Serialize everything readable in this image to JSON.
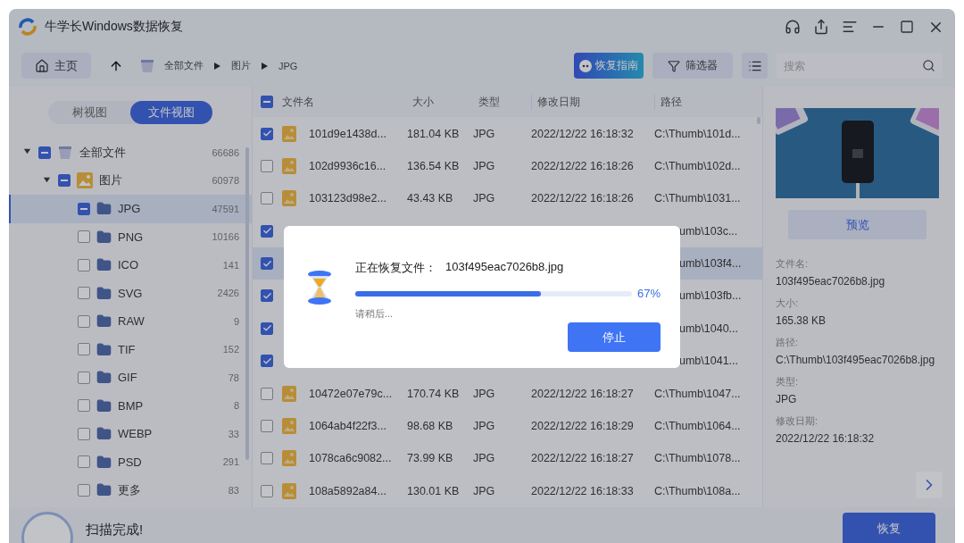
{
  "window": {
    "title": "牛学长Windows数据恢复"
  },
  "toolbar": {
    "home": "主页",
    "breadcrumb": [
      "全部文件",
      "图片",
      "JPG"
    ],
    "guide_button": "恢复指南",
    "filter_button": "筛选器",
    "search": {
      "placeholder": "搜索"
    }
  },
  "view_tabs": [
    {
      "label": "树视图",
      "selected": false
    },
    {
      "label": "文件视图",
      "selected": true
    }
  ],
  "tree": [
    {
      "label": "全部文件",
      "count": "66686",
      "kind": "drive",
      "checked": true,
      "partial": true,
      "expanded": true,
      "selected": false,
      "children": [
        {
          "label": "图片",
          "count": "60978",
          "kind": "images",
          "checked": true,
          "partial": true,
          "expanded": true,
          "selected": false,
          "children": [
            {
              "label": "JPG",
              "count": "47591",
              "kind": "folder",
              "checked": true,
              "partial": true,
              "selected": true
            },
            {
              "label": "PNG",
              "count": "10166",
              "kind": "folder",
              "checked": false,
              "partial": false,
              "selected": false
            },
            {
              "label": "ICO",
              "count": "141",
              "kind": "folder",
              "checked": false,
              "partial": false,
              "selected": false
            },
            {
              "label": "SVG",
              "count": "2426",
              "kind": "folder",
              "checked": false,
              "partial": false,
              "selected": false
            },
            {
              "label": "RAW",
              "count": "9",
              "kind": "folder",
              "checked": false,
              "partial": false,
              "selected": false
            },
            {
              "label": "TIF",
              "count": "152",
              "kind": "folder",
              "checked": false,
              "partial": false,
              "selected": false
            },
            {
              "label": "GIF",
              "count": "78",
              "kind": "folder",
              "checked": false,
              "partial": false,
              "selected": false
            },
            {
              "label": "BMP",
              "count": "8",
              "kind": "folder",
              "checked": false,
              "partial": false,
              "selected": false
            },
            {
              "label": "WEBP",
              "count": "33",
              "kind": "folder",
              "checked": false,
              "partial": false,
              "selected": false
            },
            {
              "label": "PSD",
              "count": "291",
              "kind": "folder",
              "checked": false,
              "partial": false,
              "selected": false
            },
            {
              "label": "更多",
              "count": "83",
              "kind": "folder",
              "checked": false,
              "partial": false,
              "selected": false
            }
          ]
        }
      ]
    }
  ],
  "table": {
    "header_checked": true,
    "header_partial": true,
    "columns": [
      "文件名",
      "大小",
      "类型",
      "修改日期",
      "路径"
    ],
    "rows": [
      {
        "kind": "full",
        "checked": true,
        "selected": false,
        "name": "101d9e1438d...",
        "size": "181.04 KB",
        "type": "JPG",
        "date": "2022/12/22 16:18:32",
        "path": "C:\\Thumb\\101d..."
      },
      {
        "kind": "full",
        "checked": false,
        "selected": false,
        "name": "102d9936c16...",
        "size": "136.54 KB",
        "type": "JPG",
        "date": "2022/12/22 16:18:26",
        "path": "C:\\Thumb\\102d..."
      },
      {
        "kind": "full",
        "checked": false,
        "selected": false,
        "name": "103123d98e2...",
        "size": "43.43 KB",
        "type": "JPG",
        "date": "2022/12/22 16:18:26",
        "path": "C:\\Thumb\\1031..."
      },
      {
        "kind": "covered",
        "checked": true,
        "selected": false,
        "path": "umb\\103c..."
      },
      {
        "kind": "covered",
        "checked": true,
        "selected": true,
        "path": "umb\\103f4..."
      },
      {
        "kind": "covered",
        "checked": true,
        "selected": false,
        "path": "umb\\103fb..."
      },
      {
        "kind": "covered",
        "checked": true,
        "selected": false,
        "path": "umb\\1040..."
      },
      {
        "kind": "covered",
        "checked": true,
        "selected": false,
        "path": "umb\\1041..."
      },
      {
        "kind": "full",
        "checked": false,
        "selected": false,
        "name": "10472e07e79c...",
        "size": "170.74 KB",
        "type": "JPG",
        "date": "2022/12/22 16:18:27",
        "path": "C:\\Thumb\\1047..."
      },
      {
        "kind": "full",
        "checked": false,
        "selected": false,
        "name": "1064ab4f22f3...",
        "size": "98.68 KB",
        "type": "JPG",
        "date": "2022/12/22 16:18:29",
        "path": "C:\\Thumb\\1064..."
      },
      {
        "kind": "full",
        "checked": false,
        "selected": false,
        "name": "1078ca6c9082...",
        "size": "73.99 KB",
        "type": "JPG",
        "date": "2022/12/22 16:18:27",
        "path": "C:\\Thumb\\1078..."
      },
      {
        "kind": "full",
        "checked": false,
        "selected": false,
        "name": "108a5892a84...",
        "size": "130.01 KB",
        "type": "JPG",
        "date": "2022/12/22 16:18:33",
        "path": "C:\\Thumb\\108a..."
      }
    ]
  },
  "details": {
    "preview_button": "预览",
    "fields": [
      {
        "label": "文件名:",
        "value": "103f495eac7026b8.jpg"
      },
      {
        "label": "大小:",
        "value": "165.38 KB"
      },
      {
        "label": "路径:",
        "value": "C:\\Thumb\\103f495eac7026b8.jpg"
      },
      {
        "label": "类型:",
        "value": "JPG"
      },
      {
        "label": "修改日期:",
        "value": "2022/12/22 16:18:32"
      }
    ]
  },
  "status_bar": {
    "message": "扫描完成!",
    "recover_button": "恢复"
  },
  "dialog": {
    "title": "正在恢复文件：",
    "file": "103f495eac7026b8.jpg",
    "level": 0.67,
    "percent": "67%",
    "hint": "请稍后...",
    "stop_button": "停止"
  }
}
